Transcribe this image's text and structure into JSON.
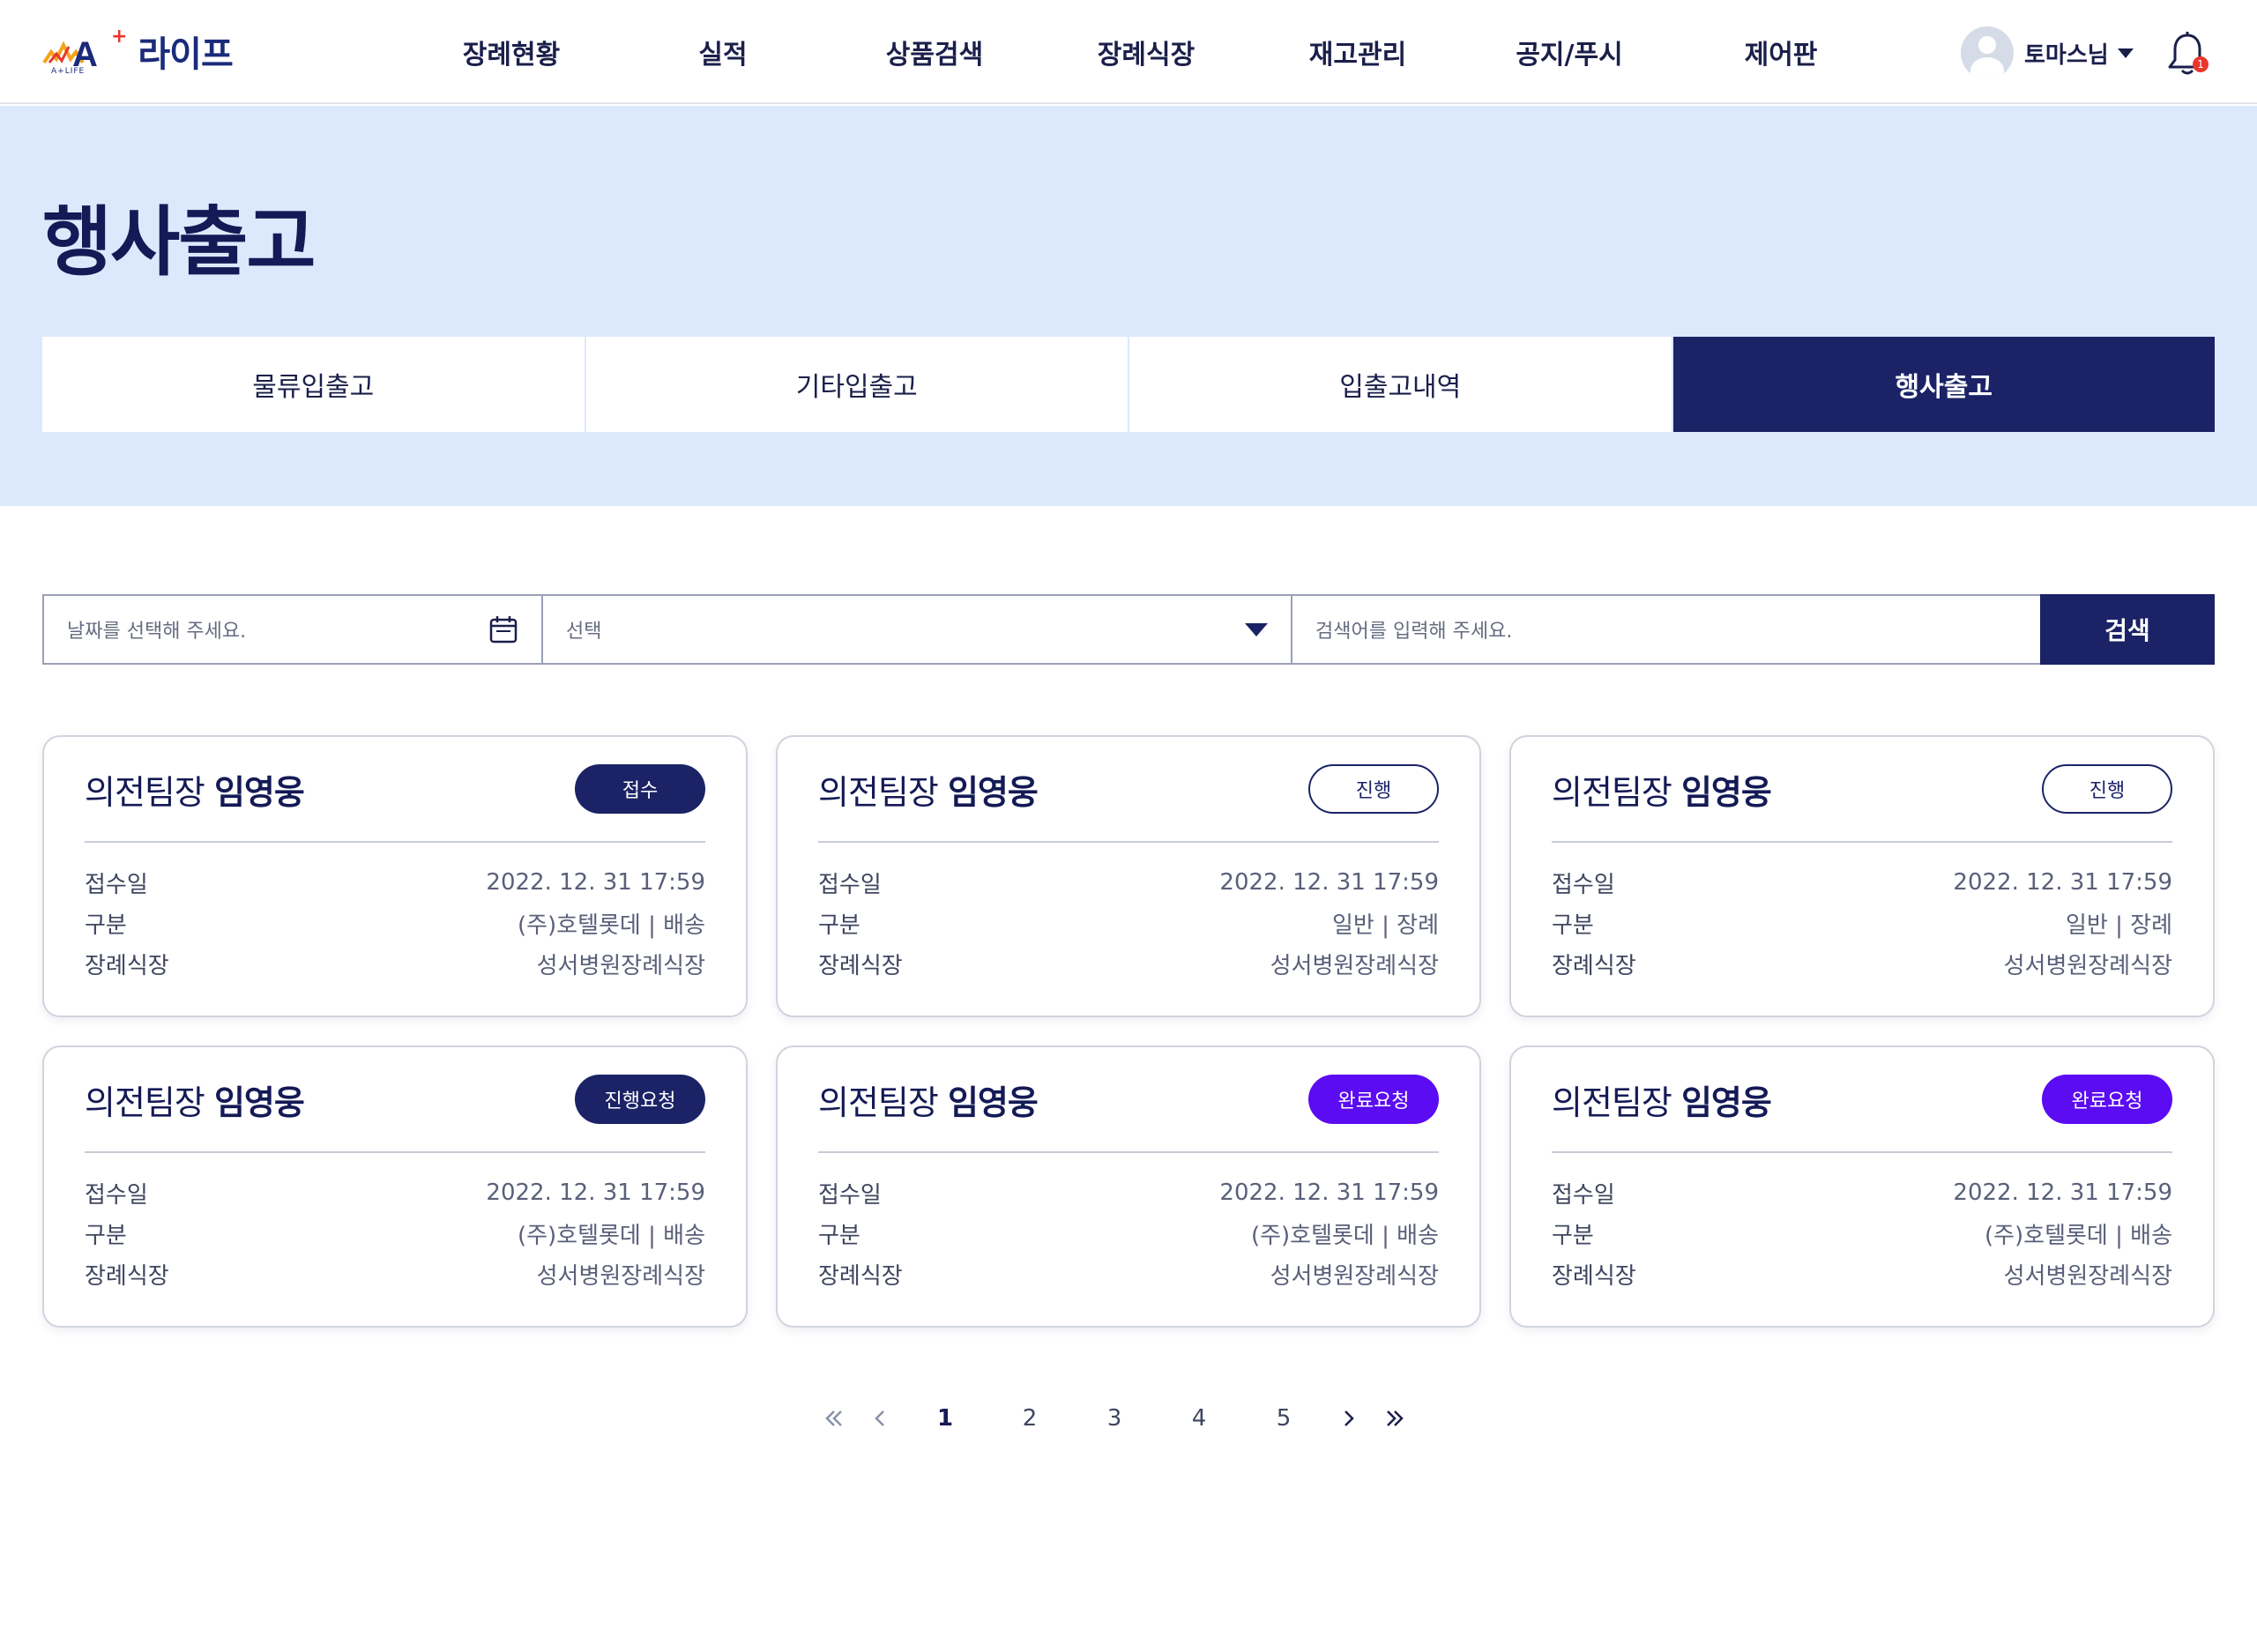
{
  "header": {
    "logo_text": "A",
    "logo_plus": "+",
    "logo_word": "라이프",
    "logo_sub": "A+LIFE",
    "nav": [
      "장례현황",
      "실적",
      "상품검색",
      "장례식장",
      "재고관리",
      "공지/푸시",
      "제어판"
    ],
    "user_name": "토마스님",
    "notification_count": "1"
  },
  "page": {
    "title": "행사출고",
    "tabs": [
      {
        "label": "물류입출고",
        "active": false
      },
      {
        "label": "기타입출고",
        "active": false
      },
      {
        "label": "입출고내역",
        "active": false
      },
      {
        "label": "행사출고",
        "active": true
      }
    ]
  },
  "search": {
    "date_placeholder": "날짜를 선택해 주세요.",
    "select_value": "선택",
    "keyword_placeholder": "검색어를 입력해 주세요.",
    "button_label": "검색"
  },
  "cards": [
    {
      "role": "의전팀장",
      "name": "임영웅",
      "status": "접수",
      "status_style": "dark",
      "rows": [
        {
          "k": "접수일",
          "v": "2022. 12. 31 17:59"
        },
        {
          "k": "구분",
          "v": "(주)호텔롯데 | 배송"
        },
        {
          "k": "장례식장",
          "v": "성서병원장례식장"
        }
      ]
    },
    {
      "role": "의전팀장",
      "name": "임영웅",
      "status": "진행",
      "status_style": "outline",
      "rows": [
        {
          "k": "접수일",
          "v": "2022. 12. 31 17:59"
        },
        {
          "k": "구분",
          "v": "일반 | 장례"
        },
        {
          "k": "장례식장",
          "v": "성서병원장례식장"
        }
      ]
    },
    {
      "role": "의전팀장",
      "name": "임영웅",
      "status": "진행",
      "status_style": "outline",
      "rows": [
        {
          "k": "접수일",
          "v": "2022. 12. 31 17:59"
        },
        {
          "k": "구분",
          "v": "일반 | 장례"
        },
        {
          "k": "장례식장",
          "v": "성서병원장례식장"
        }
      ]
    },
    {
      "role": "의전팀장",
      "name": "임영웅",
      "status": "진행요청",
      "status_style": "dark",
      "rows": [
        {
          "k": "접수일",
          "v": "2022. 12. 31 17:59"
        },
        {
          "k": "구분",
          "v": "(주)호텔롯데 | 배송"
        },
        {
          "k": "장례식장",
          "v": "성서병원장례식장"
        }
      ]
    },
    {
      "role": "의전팀장",
      "name": "임영웅",
      "status": "완료요청",
      "status_style": "purple",
      "rows": [
        {
          "k": "접수일",
          "v": "2022. 12. 31 17:59"
        },
        {
          "k": "구분",
          "v": "(주)호텔롯데 | 배송"
        },
        {
          "k": "장례식장",
          "v": "성서병원장례식장"
        }
      ]
    },
    {
      "role": "의전팀장",
      "name": "임영웅",
      "status": "완료요청",
      "status_style": "purple",
      "rows": [
        {
          "k": "접수일",
          "v": "2022. 12. 31 17:59"
        },
        {
          "k": "구분",
          "v": "(주)호텔롯데 | 배송"
        },
        {
          "k": "장례식장",
          "v": "성서병원장례식장"
        }
      ]
    }
  ],
  "pagination": {
    "pages": [
      "1",
      "2",
      "3",
      "4",
      "5"
    ],
    "current": "1"
  },
  "colors": {
    "navy": "#1b2366",
    "hero_bg": "#dce9fd",
    "purple": "#5b0cf2",
    "alert_red": "#e8362d"
  }
}
